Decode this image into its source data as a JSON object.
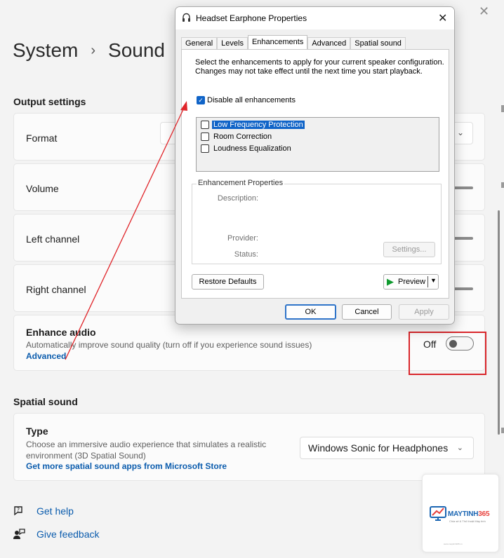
{
  "settings": {
    "breadcrumb": {
      "parent": "System",
      "separator": "›",
      "current": "Sound"
    },
    "output_settings": {
      "heading": "Output settings",
      "format_label": "Format",
      "volume_label": "Volume",
      "left_channel_label": "Left channel",
      "right_channel_label": "Right channel",
      "enhance_audio": {
        "title": "Enhance audio",
        "description": "Automatically improve sound quality (turn off if you experience sound issues)",
        "link": "Advanced",
        "state": "Off",
        "enabled": false
      }
    },
    "spatial_sound": {
      "heading": "Spatial sound",
      "type_title": "Type",
      "type_description": "Choose an immersive audio experience that simulates a realistic environment (3D Spatial Sound)",
      "store_link": "Get more spatial sound apps from Microsoft Store",
      "selected": "Windows Sonic for Headphones"
    },
    "help": {
      "get_help": "Get help",
      "give_feedback": "Give feedback"
    }
  },
  "dialog": {
    "title": "Headset Earphone Properties",
    "tabs": [
      "General",
      "Levels",
      "Enhancements",
      "Advanced",
      "Spatial sound"
    ],
    "active_tab": "Enhancements",
    "intro": "Select the enhancements to apply for your current speaker configuration. Changes may not take effect until the next time you start playback.",
    "disable_all": {
      "label": "Disable all enhancements",
      "checked": true
    },
    "enhancements": [
      {
        "label": "Low Frequency Protection",
        "checked": false,
        "selected": true
      },
      {
        "label": "Room Correction",
        "checked": false,
        "selected": false
      },
      {
        "label": "Loudness Equalization",
        "checked": false,
        "selected": false
      }
    ],
    "properties": {
      "title": "Enhancement Properties",
      "description_label": "Description:",
      "provider_label": "Provider:",
      "status_label": "Status:",
      "settings_button": "Settings..."
    },
    "restore_defaults": "Restore Defaults",
    "preview": "Preview",
    "ok": "OK",
    "cancel": "Cancel",
    "apply": "Apply"
  },
  "watermark": {
    "brand_main": "MAYTINH",
    "brand_number": "365",
    "tagline": "Chia sẻ & Thủ thuật Máy tính",
    "footer": "www.maytinh365.vn"
  },
  "colors": {
    "accent_link": "#0b5cad",
    "highlight_box": "#d9262b",
    "checkbox_accent": "#1064c8",
    "preview_play": "#0e9a2e"
  }
}
